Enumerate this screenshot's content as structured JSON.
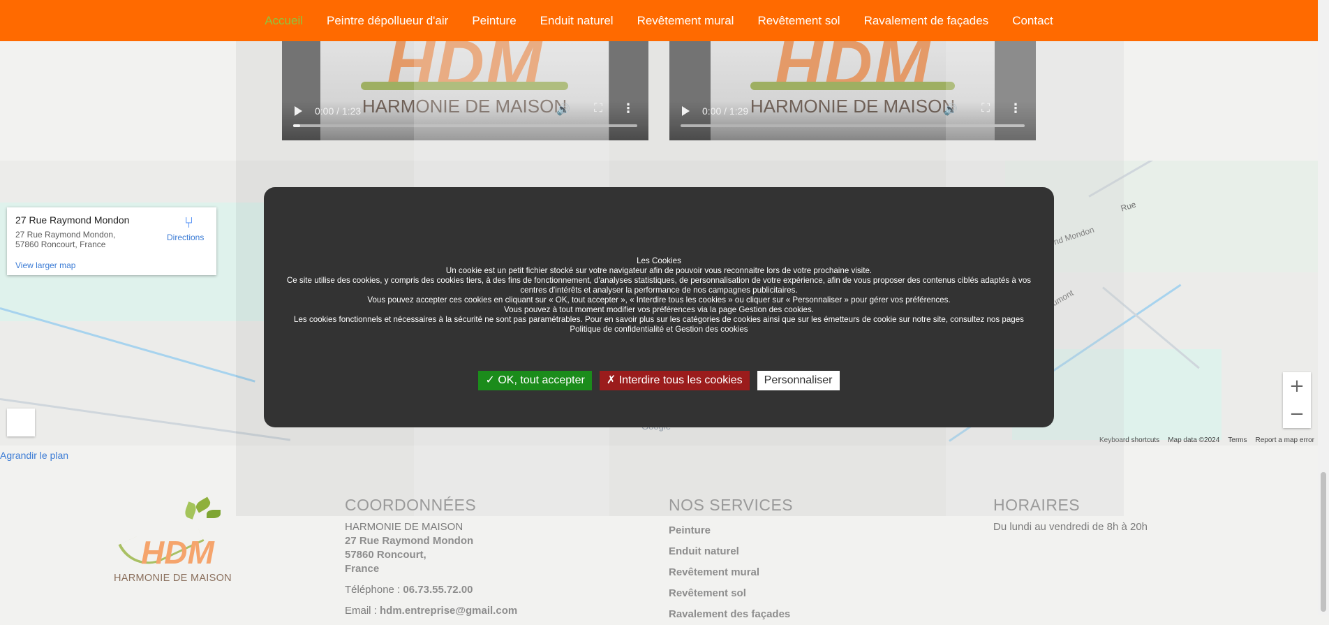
{
  "nav": {
    "items": [
      {
        "label": "Accueil",
        "active": true
      },
      {
        "label": "Peintre dépollueur d'air"
      },
      {
        "label": "Peinture"
      },
      {
        "label": "Enduit naturel"
      },
      {
        "label": "Revêtement mural"
      },
      {
        "label": "Revêtement sol"
      },
      {
        "label": "Ravalement de façades"
      },
      {
        "label": "Contact"
      }
    ],
    "colors": {
      "bar": "#ff6a00",
      "active": "#8dc63f"
    }
  },
  "videos": [
    {
      "time": "0:00 / 1:23",
      "progress": 0.02,
      "poster_brand": "HDM",
      "poster_sub": "HARMONIE DE MAISON"
    },
    {
      "time": "0:00 / 1:29",
      "progress": 0.0,
      "poster_brand": "HDM",
      "poster_sub": "HARMONIE DE MAISON"
    }
  ],
  "map": {
    "card": {
      "title": "27 Rue Raymond Mondon",
      "address": "27 Rue Raymond Mondon, 57860 Roncourt, France",
      "directions": "Directions",
      "larger": "View larger map"
    },
    "street_labels": [
      "nd Mondon",
      "Rue",
      "umont"
    ],
    "footer": [
      "Keyboard shortcuts",
      "Map data ©2024",
      "Terms",
      "Report a map error"
    ],
    "zoom_in": "+",
    "zoom_out": "−",
    "google": "Google",
    "expand": "Agrandir le plan"
  },
  "cookie": {
    "title": "Les Cookies",
    "lines": [
      "Un cookie est un petit fichier stocké sur votre navigateur afin de pouvoir vous reconnaitre lors de votre prochaine visite.",
      "Ce site utilise des cookies, y compris des cookies tiers, à des fins de fonctionnement, d'analyses statistiques, de personnalisation de votre expérience, afin de vous proposer des contenus ciblés adaptés à vos centres d'intérêts et analyser la performance de nos campagnes publicitaires.",
      "Vous pouvez accepter ces cookies en cliquant sur « OK, tout accepter », «  Interdire tous les cookies  » ou cliquer sur « Personnaliser » pour gérer vos préférences.",
      "Vous pouvez à tout moment modifier vos préférences via la page Gestion des cookies.",
      "Les cookies fonctionnels et nécessaires à la sécurité ne sont pas paramétrables. Pour en savoir plus sur les catégories de cookies ainsi que sur les émetteurs de cookie sur notre site, consultez nos pages Politique de confidentialité et Gestion des cookies"
    ],
    "buttons": {
      "accept": "✓ OK, tout accepter",
      "deny": "✗ Interdire tous les cookies",
      "customize": "Personnaliser"
    },
    "colors": {
      "bg": "#333333",
      "accept": "#1b8c1b",
      "deny": "#9b1c1c"
    }
  },
  "footer": {
    "logo": {
      "brand": "HDM",
      "sub": "HARMONIE DE MAISON"
    },
    "coordonnees": {
      "heading": "COORDONNÉES",
      "company": "HARMONIE DE MAISON",
      "street": "27 Rue Raymond Mondon",
      "city": "57860 Roncourt,",
      "country": "France",
      "phone_label": "Téléphone :",
      "phone": "06.73.55.72.00",
      "email_label": "Email :",
      "email": "hdm.entreprise@gmail.com"
    },
    "services": {
      "heading": "NOS SERVICES",
      "items": [
        "Peinture",
        "Enduit naturel",
        "Revêtement mural",
        "Revêtement sol",
        "Ravalement des façades"
      ]
    },
    "horaires": {
      "heading": "HORAIRES",
      "text": "Du lundi au vendredi de 8h à 20h"
    }
  }
}
